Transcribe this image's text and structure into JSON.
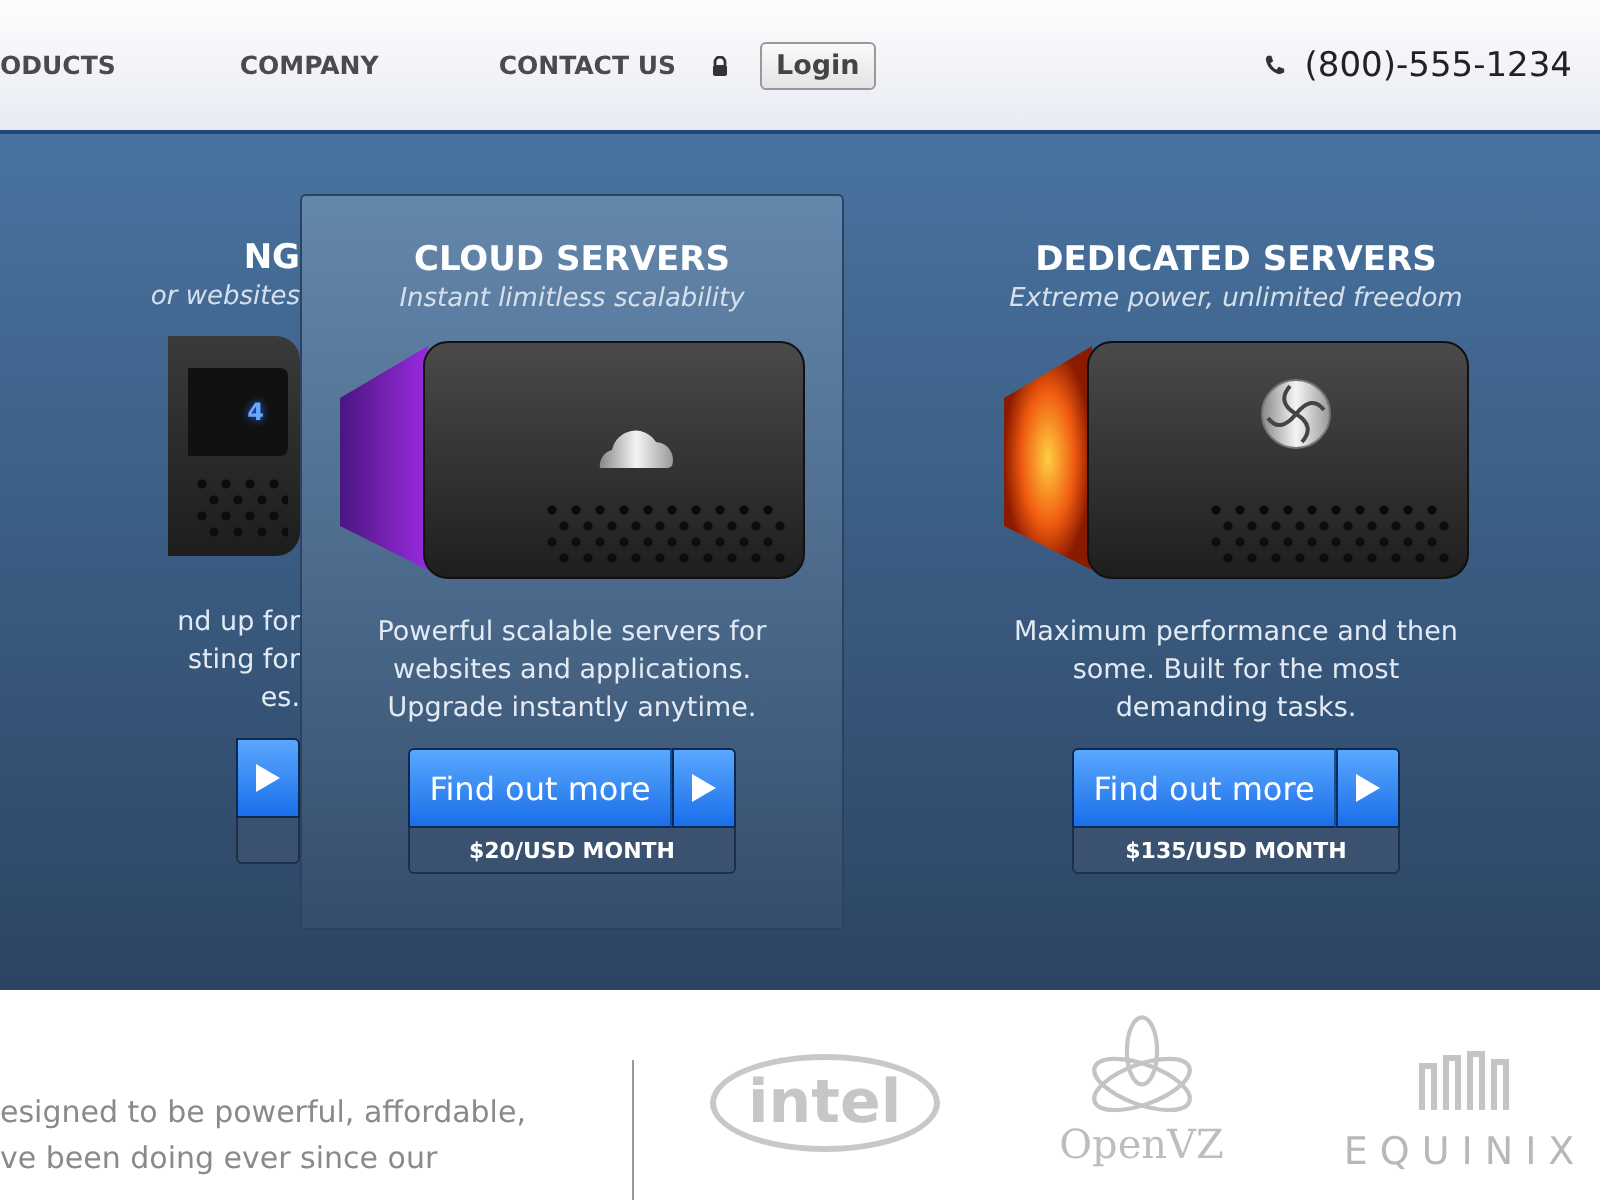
{
  "nav": {
    "items": [
      {
        "label": "ODUCTS"
      },
      {
        "label": "COMPANY"
      },
      {
        "label": "CONTACT US"
      }
    ],
    "login": "Login",
    "phone": "(800)-555-1234"
  },
  "plans": [
    {
      "kind": "display",
      "highlighted": false,
      "title": "NG",
      "tagline": "or websites",
      "display_text": "4",
      "description": [
        "nd up for",
        "sting for",
        "es."
      ]
    },
    {
      "kind": "cloud",
      "highlighted": true,
      "title": "CLOUD SERVERS",
      "tagline": "Instant limitless scalability",
      "description": [
        "Powerful scalable servers for",
        "websites and applications.",
        "Upgrade instantly anytime."
      ],
      "button": "Find out more",
      "price": "$20/USD MONTH"
    },
    {
      "kind": "fire",
      "highlighted": false,
      "title": "DEDICATED SERVERS",
      "tagline": "Extreme power, unlimited freedom",
      "description": [
        "Maximum performance and then",
        "some. Built for the most",
        "demanding tasks."
      ],
      "button": "Find out more",
      "price": "$135/USD MONTH"
    }
  ],
  "about": {
    "lines": [
      "esigned to be powerful, affordable,",
      "ve been doing ever since our"
    ]
  },
  "partners": [
    {
      "kind": "intel",
      "name": "intel"
    },
    {
      "kind": "openvz",
      "name": "OpenVZ"
    },
    {
      "kind": "equinix",
      "name": "EQUINIX"
    }
  ]
}
